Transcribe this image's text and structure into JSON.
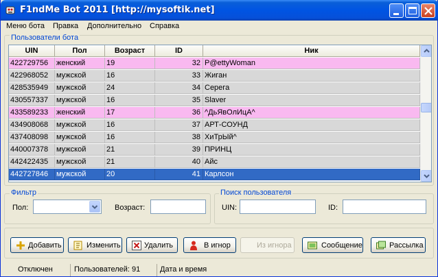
{
  "window": {
    "title": "F1ndMe Bot 2011 [http://mysoftik.net]"
  },
  "menu": [
    "Меню бота",
    "Правка",
    "Дополнительно",
    "Справка"
  ],
  "users_group": {
    "title": "Пользователи бота"
  },
  "grid": {
    "columns": [
      "UIN",
      "Пол",
      "Возраст",
      "ID",
      "Ник"
    ],
    "rows": [
      {
        "uin": "422729756",
        "sex": "женский",
        "age": "19",
        "id": "32",
        "nick": "P@ettyWoman",
        "style": "female"
      },
      {
        "uin": "422968052",
        "sex": "мужской",
        "age": "16",
        "id": "33",
        "nick": "Жиган",
        "style": "male"
      },
      {
        "uin": "428535949",
        "sex": "мужской",
        "age": "24",
        "id": "34",
        "nick": "Серега",
        "style": "male"
      },
      {
        "uin": "430557337",
        "sex": "мужской",
        "age": "16",
        "id": "35",
        "nick": "Slaver",
        "style": "male"
      },
      {
        "uin": "433589233",
        "sex": "женский",
        "age": "17",
        "id": "36",
        "nick": "^ДьЯвОлИцА^",
        "style": "female"
      },
      {
        "uin": "434908068",
        "sex": "мужской",
        "age": "16",
        "id": "37",
        "nick": "АРТ-СОУНД",
        "style": "male"
      },
      {
        "uin": "437408098",
        "sex": "мужской",
        "age": "16",
        "id": "38",
        "nick": "ХиТрЫй^",
        "style": "male"
      },
      {
        "uin": "440007378",
        "sex": "мужской",
        "age": "21",
        "id": "39",
        "nick": "ПРИНЦ",
        "style": "male"
      },
      {
        "uin": "442422435",
        "sex": "мужской",
        "age": "21",
        "id": "40",
        "nick": "Айс",
        "style": "male"
      },
      {
        "uin": "442727846",
        "sex": "мужской",
        "age": "20",
        "id": "41",
        "nick": "Карлсон",
        "style": "selected"
      }
    ]
  },
  "filter": {
    "title": "Фильтр",
    "sex_label": "Пол:",
    "sex_value": "",
    "age_label": "Возраст:",
    "age_value": ""
  },
  "search": {
    "title": "Поиск пользователя",
    "uin_label": "UIN:",
    "uin_value": "",
    "id_label": "ID:",
    "id_value": ""
  },
  "buttons": {
    "add": "Добавить",
    "edit": "Изменить",
    "delete": "Удалить",
    "ignore": "В игнор",
    "unignore": "Из игнора",
    "message": "Сообщение",
    "mailing": "Рассылка"
  },
  "status": {
    "state": "Отключен",
    "users_count": "Пользователей: 91",
    "datetime": "Дата и время"
  },
  "colors": {
    "female_row": "#f9b9f0",
    "male_row": "#d8d8d8",
    "selected_row": "#316ac5",
    "title_bar": "#0054e3"
  },
  "icons": {
    "app": "robot-icon",
    "add": "plus-icon",
    "edit": "edit-icon",
    "delete": "delete-x-icon",
    "ignore": "ignore-user-icon",
    "unignore": "unignore-user-icon",
    "message": "message-icon",
    "mailing": "mailing-icon"
  }
}
